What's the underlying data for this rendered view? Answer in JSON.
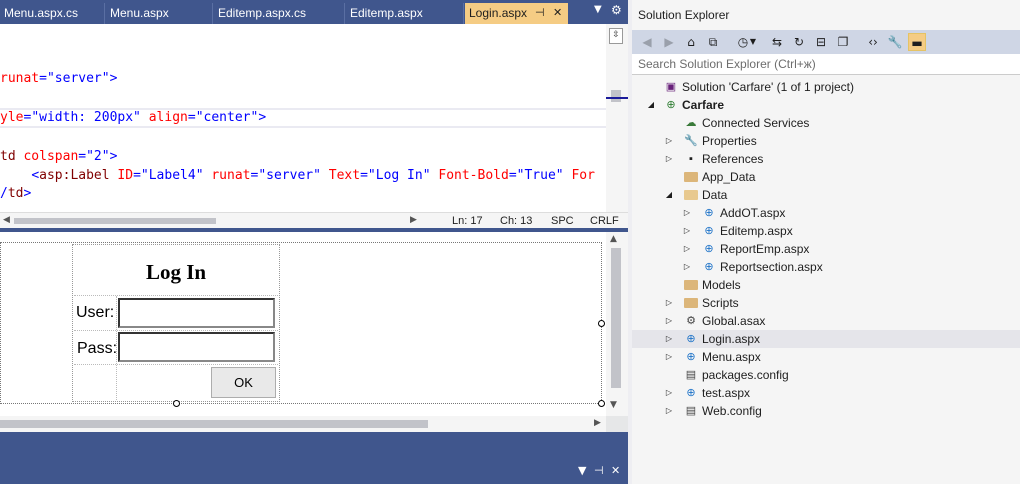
{
  "tabs": [
    {
      "label": "Menu.aspx.cs",
      "active": false
    },
    {
      "label": "Menu.aspx",
      "active": false
    },
    {
      "label": "Editemp.aspx.cs",
      "active": false
    },
    {
      "label": "Editemp.aspx",
      "active": false
    },
    {
      "label": "Login.aspx",
      "active": true
    }
  ],
  "code_lines": [
    {
      "parts": [
        [
          "attr",
          "runat"
        ],
        [
          "punct",
          "="
        ],
        [
          "val",
          "\"server\""
        ],
        [
          "punct",
          ">"
        ]
      ]
    },
    {
      "parts": [
        [
          "attr",
          "yle"
        ],
        [
          "punct",
          "="
        ],
        [
          "val",
          "\"width: 200px\""
        ],
        [
          "text",
          " "
        ],
        [
          "attr",
          "align"
        ],
        [
          "punct",
          "="
        ],
        [
          "val",
          "\"center\""
        ],
        [
          "punct",
          ">"
        ]
      ]
    },
    {
      "parts": [
        [
          "tag",
          "td"
        ],
        [
          "text",
          " "
        ],
        [
          "attr",
          "colspan"
        ],
        [
          "punct",
          "="
        ],
        [
          "val",
          "\"2\""
        ],
        [
          "punct",
          ">"
        ]
      ]
    },
    {
      "parts": [
        [
          "text",
          "    "
        ],
        [
          "punct",
          "<"
        ],
        [
          "tag",
          "asp:Label"
        ],
        [
          "text",
          " "
        ],
        [
          "attr",
          "ID"
        ],
        [
          "punct",
          "="
        ],
        [
          "val",
          "\"Label4\""
        ],
        [
          "text",
          " "
        ],
        [
          "attr",
          "runat"
        ],
        [
          "punct",
          "="
        ],
        [
          "val",
          "\"server\""
        ],
        [
          "text",
          " "
        ],
        [
          "attr",
          "Text"
        ],
        [
          "punct",
          "="
        ],
        [
          "val",
          "\"Log In\""
        ],
        [
          "text",
          " "
        ],
        [
          "attr",
          "Font-Bold"
        ],
        [
          "punct",
          "="
        ],
        [
          "val",
          "\"True\""
        ],
        [
          "text",
          " "
        ],
        [
          "attr",
          "For"
        ]
      ]
    },
    {
      "parts": [
        [
          "punct",
          "/"
        ],
        [
          "tag",
          "td"
        ],
        [
          "punct",
          ">"
        ]
      ]
    }
  ],
  "status": {
    "line": "Ln: 17",
    "col": "Ch: 13",
    "mode": "SPC",
    "eol": "CRLF"
  },
  "design": {
    "title": "Log In",
    "user_label": "User:",
    "pass_label": "Pass:",
    "ok_label": "OK"
  },
  "solution_explorer": {
    "title": "Solution Explorer",
    "search_placeholder": "Search Solution Explorer (Ctrl+ж)",
    "nodes": [
      {
        "label": "Solution 'Carfare' (1 of 1 project)",
        "level": 0,
        "arrow": "",
        "icon": "solution"
      },
      {
        "label": "Carfare",
        "level": 0,
        "arrow": "expanded",
        "icon": "project",
        "bold": true
      },
      {
        "label": "Connected Services",
        "level": 1,
        "arrow": "",
        "icon": "cloud"
      },
      {
        "label": "Properties",
        "level": 1,
        "arrow": "collapsed",
        "icon": "wrench"
      },
      {
        "label": "References",
        "level": 1,
        "arrow": "collapsed",
        "icon": "references"
      },
      {
        "label": "App_Data",
        "level": 1,
        "arrow": "",
        "icon": "folder"
      },
      {
        "label": "Data",
        "level": 1,
        "arrow": "expanded",
        "icon": "folder-open"
      },
      {
        "label": "AddOT.aspx",
        "level": 2,
        "arrow": "collapsed",
        "icon": "web"
      },
      {
        "label": "Editemp.aspx",
        "level": 2,
        "arrow": "collapsed",
        "icon": "web"
      },
      {
        "label": "ReportEmp.aspx",
        "level": 2,
        "arrow": "collapsed",
        "icon": "web"
      },
      {
        "label": "Reportsection.aspx",
        "level": 2,
        "arrow": "collapsed",
        "icon": "web"
      },
      {
        "label": "Models",
        "level": 1,
        "arrow": "",
        "icon": "folder"
      },
      {
        "label": "Scripts",
        "level": 1,
        "arrow": "collapsed",
        "icon": "folder"
      },
      {
        "label": "Global.asax",
        "level": 1,
        "arrow": "collapsed",
        "icon": "gear"
      },
      {
        "label": "Login.aspx",
        "level": 1,
        "arrow": "collapsed",
        "icon": "web",
        "selected": true
      },
      {
        "label": "Menu.aspx",
        "level": 1,
        "arrow": "collapsed",
        "icon": "web"
      },
      {
        "label": "packages.config",
        "level": 1,
        "arrow": "",
        "icon": "config"
      },
      {
        "label": "test.aspx",
        "level": 1,
        "arrow": "collapsed",
        "icon": "web"
      },
      {
        "label": "Web.config",
        "level": 1,
        "arrow": "collapsed",
        "icon": "config"
      }
    ]
  },
  "colors": {
    "chrome": "#40568d",
    "active_tab": "#f5cc84",
    "attr": "#ff0000",
    "value": "#0000ff",
    "tag": "#800000"
  }
}
